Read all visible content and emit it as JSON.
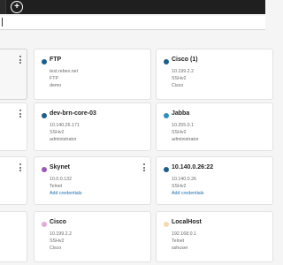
{
  "toolbar": {
    "add_tab_symbol": "+"
  },
  "cards": {
    "c1": {
      "name": "FTP",
      "lines": [
        "test.rebex.net",
        "FTP",
        "demo"
      ],
      "dot": "#1b5e8c"
    },
    "c2": {
      "name": "Cisco (1)",
      "lines": [
        "10.199.2.2",
        "SSHv2",
        "Cisco"
      ],
      "dot": "#1b5e8c"
    },
    "c3": {
      "name": "dev-brn-core-03",
      "lines": [
        "10.140.26.171",
        "SSHv2",
        "administrator"
      ],
      "dot": "#1b5e8c"
    },
    "c4": {
      "name": "Jabba",
      "lines": [
        "10.255.0.1",
        "SSHv2",
        "administrator"
      ],
      "dot": "#2a8fbd"
    },
    "c5": {
      "name": "Skynet",
      "lines": [
        "10.0.0.132",
        "Telnet"
      ],
      "link": "Add credentials",
      "dot": "#9b59b6"
    },
    "c6": {
      "name": "10.140.0.26:22",
      "lines": [
        "10.140.0.26",
        "SSHv2"
      ],
      "link": "Add credentials",
      "dot": "#1b5e8c"
    },
    "c7": {
      "name": "Cisco",
      "lines": [
        "10.199.2.2",
        "SSHv2",
        "Cisco"
      ],
      "dot": "#e6a8d9"
    },
    "c8": {
      "name": "LocalHost",
      "lines": [
        "192.168.0.1",
        "Telnet",
        "sshuser"
      ],
      "dot": "#f7d9b0"
    }
  }
}
